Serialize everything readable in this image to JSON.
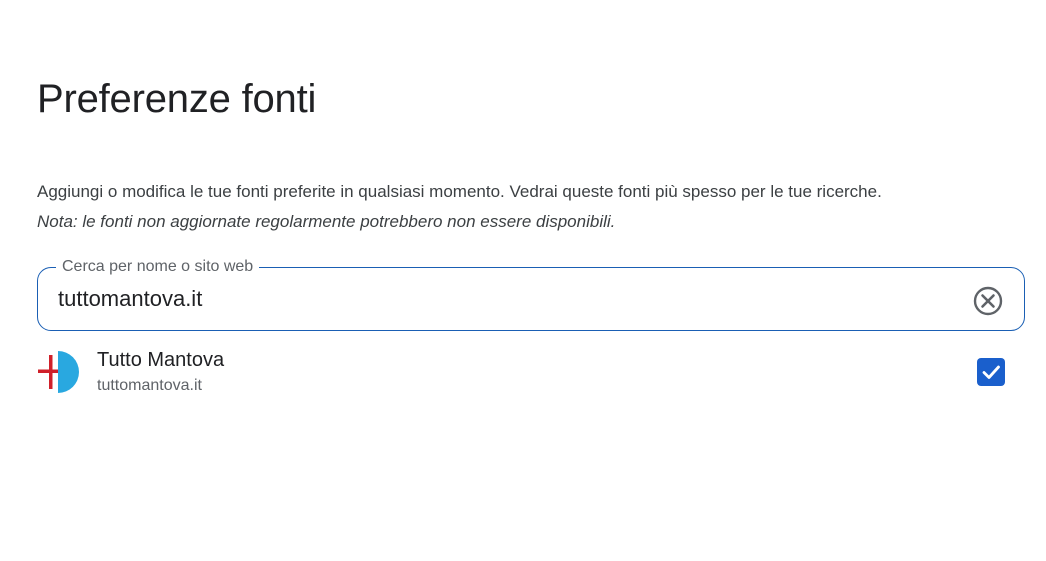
{
  "page": {
    "title": "Preferenze fonti",
    "description": "Aggiungi o modifica le tue fonti preferite in qualsiasi momento. Vedrai queste fonti più spesso per le tue ricerche.",
    "note": "Nota: le fonti non aggiornate regolarmente potrebbero non essere disponibili."
  },
  "search": {
    "label": "Cerca per nome o sito web",
    "value": "tuttomantova.it",
    "clear_icon": "clear-circle-icon"
  },
  "results": [
    {
      "name": "Tutto Mantova",
      "domain": "tuttomantova.it",
      "favicon_icon": "tutto-mantova-logo-icon",
      "checked": true
    }
  ],
  "colors": {
    "accent": "#1a5fb4",
    "checkbox": "#1a5fcc",
    "logo_red": "#d0202a",
    "logo_blue": "#29a8e0"
  }
}
